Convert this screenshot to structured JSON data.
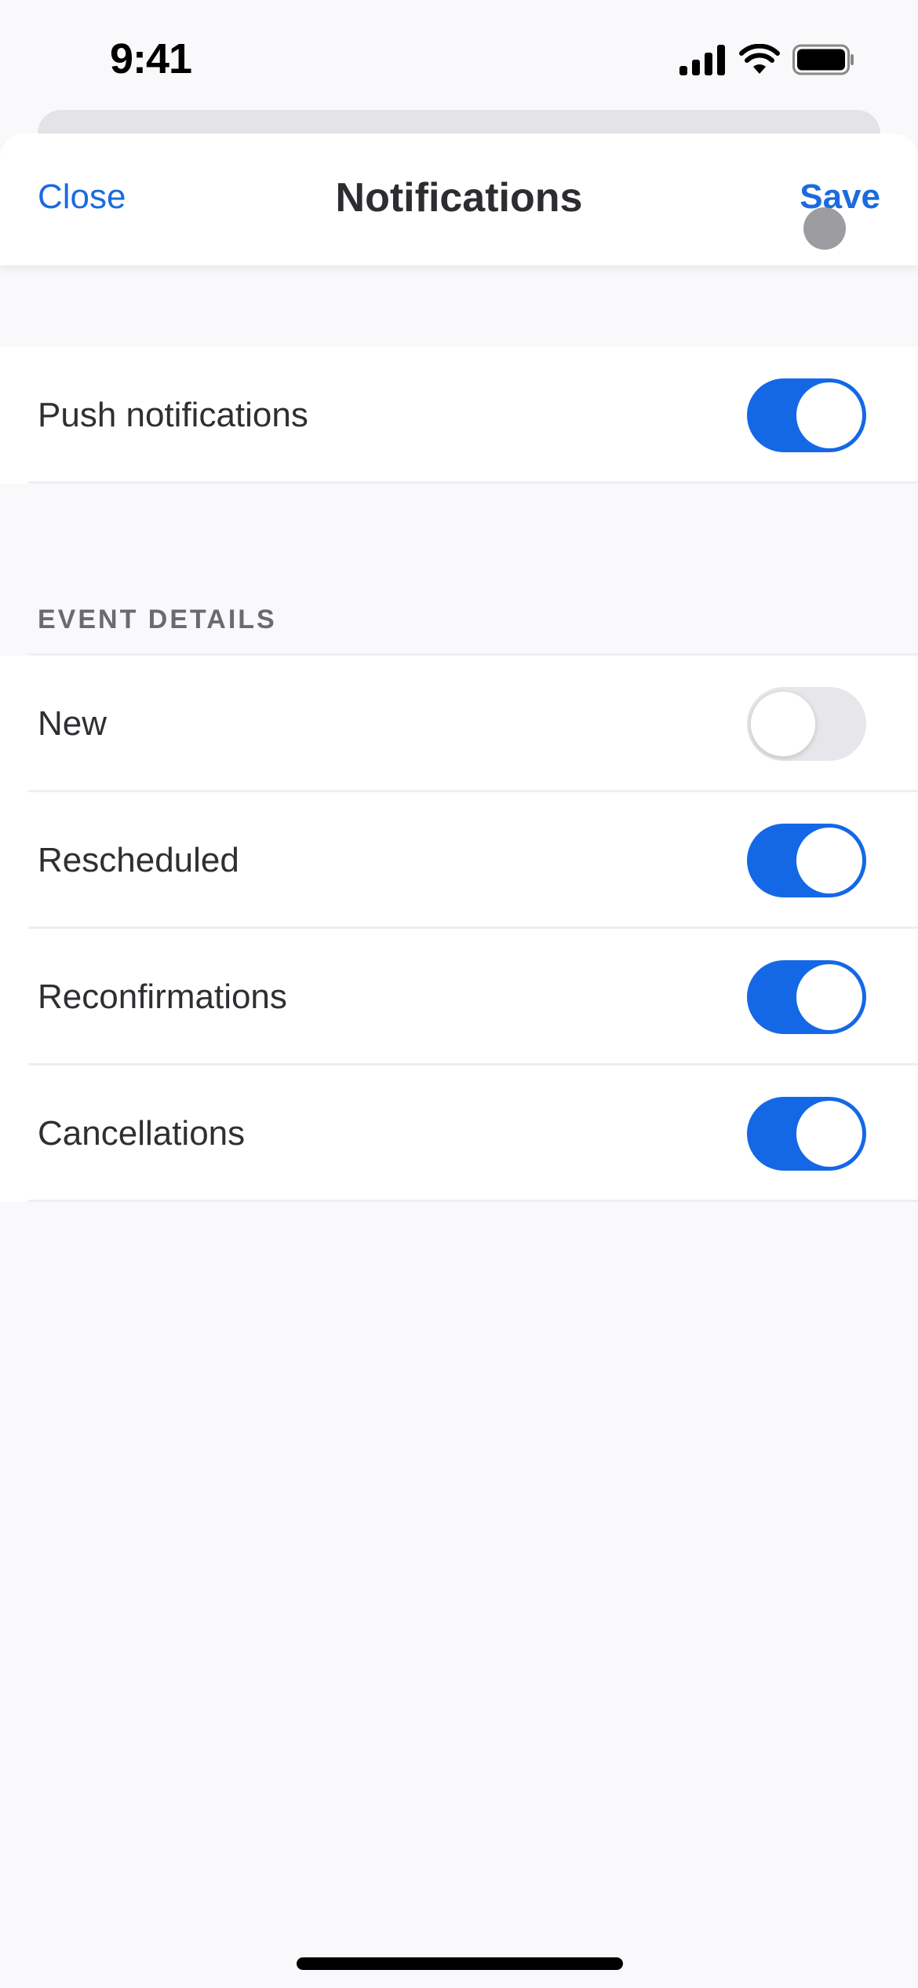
{
  "status_bar": {
    "time": "9:41",
    "icons": [
      "cellular-signal-icon",
      "wifi-icon",
      "battery-icon"
    ]
  },
  "navbar": {
    "close_label": "Close",
    "title": "Notifications",
    "save_label": "Save"
  },
  "push": {
    "label": "Push notifications",
    "enabled": true
  },
  "event_details": {
    "header": "EVENT DETAILS",
    "items": [
      {
        "label": "New",
        "enabled": false
      },
      {
        "label": "Rescheduled",
        "enabled": true
      },
      {
        "label": "Reconfirmations",
        "enabled": true
      },
      {
        "label": "Cancellations",
        "enabled": true
      }
    ]
  },
  "colors": {
    "accent": "#1468e6",
    "link": "#1a6bdf",
    "toggle_off": "#e7e6ea",
    "background": "#f9f8fb"
  }
}
